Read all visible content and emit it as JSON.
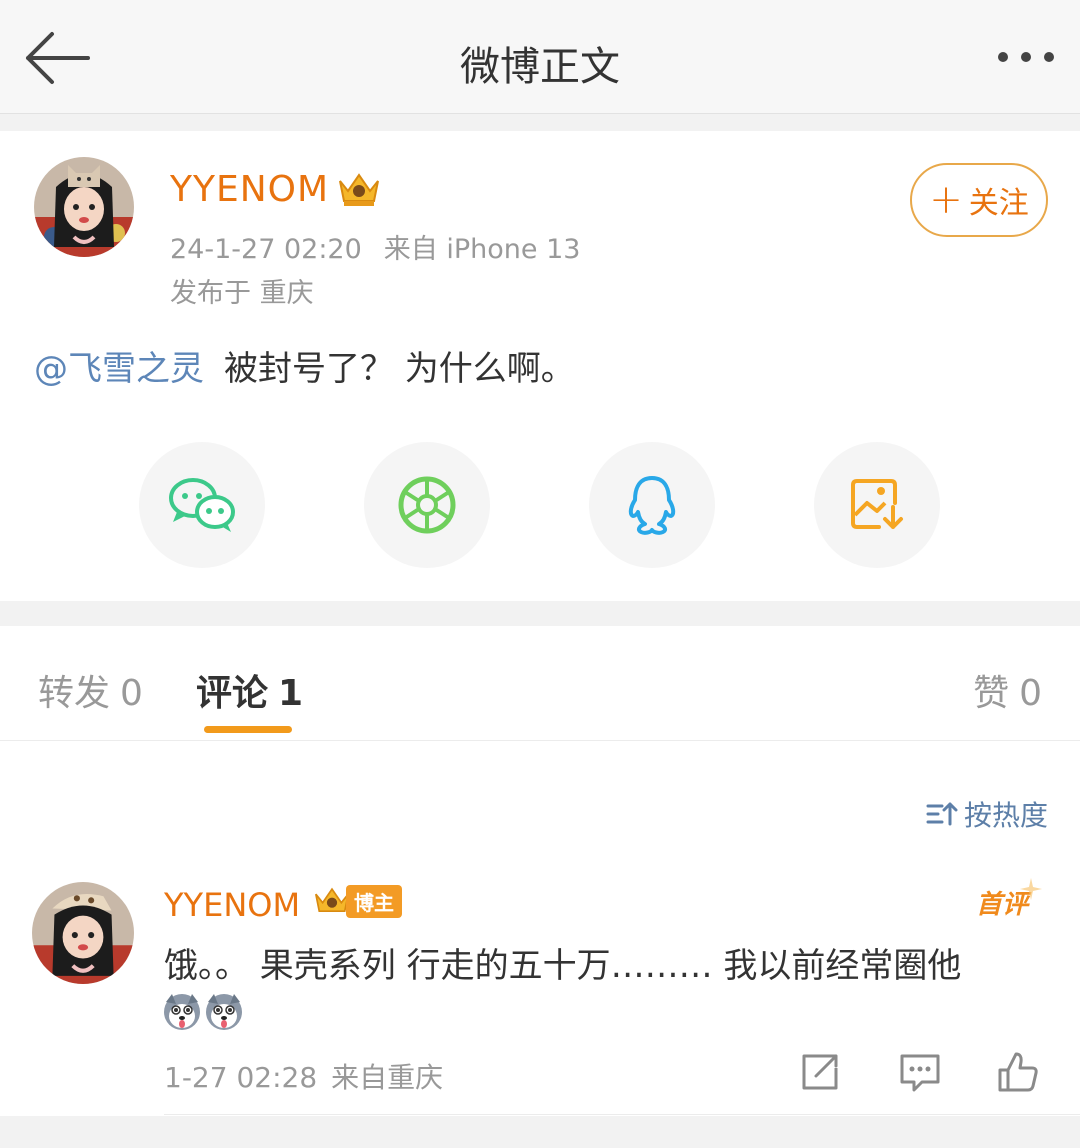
{
  "colors": {
    "accent_orange": "#e8730f",
    "tab_underline": "#f29a1b",
    "link_blue": "#5d86b8",
    "muted_gray": "#999999",
    "wechat_green": "#3cc98a",
    "moments_green": "#6fcf5c",
    "qq_blue": "#29a8e8",
    "save_orange": "#f5a623"
  },
  "nav": {
    "title": "微博正文",
    "back_icon": "back-arrow-icon",
    "more_icon": "more-dots-icon"
  },
  "post": {
    "username": "YYENOM",
    "time": "24-1-27 02:20",
    "source": "来自 iPhone 13",
    "location": "发布于 重庆",
    "follow_plus": "+",
    "follow_label": "关注",
    "mention": "@飞雪之灵",
    "text": "被封号了？ 为什么啊。",
    "share_icons": [
      "wechat-icon",
      "moments-icon",
      "qq-icon",
      "save-image-icon"
    ]
  },
  "tabs": [
    {
      "label": "转发",
      "count": "0"
    },
    {
      "label": "评论",
      "count": "1"
    },
    {
      "label": "赞",
      "count": "0"
    }
  ],
  "sort": {
    "label": "按热度",
    "icon": "sort-icon"
  },
  "comment": {
    "username": "YYENOM",
    "badge_label": "博主",
    "first_label": "首评",
    "text": "饿。。 果壳系列 行走的五十万……… 我以前经常圈他",
    "emojis": [
      "husky-emoji",
      "husky-emoji"
    ],
    "time": "1-27 02:28",
    "source": "来自重庆",
    "actions": [
      "repost-icon",
      "reply-icon",
      "like-icon"
    ]
  }
}
